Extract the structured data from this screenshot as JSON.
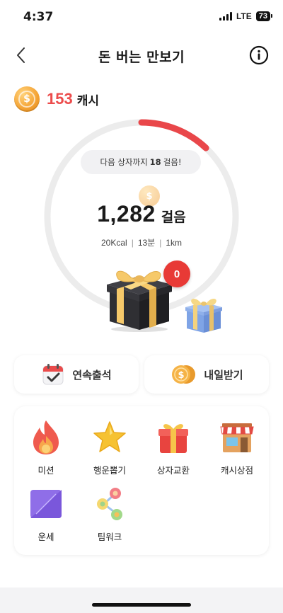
{
  "status_bar": {
    "time": "4:37",
    "network": "LTE",
    "battery": "73"
  },
  "header": {
    "title": "돈 버는 만보기"
  },
  "cash": {
    "amount": "153",
    "unit": "캐시"
  },
  "progress": {
    "next_box_prefix": "다음 상자까지",
    "next_box_steps": "18",
    "next_box_suffix": "걸음!",
    "ring_fill_fraction": 0.12
  },
  "steps": {
    "count": "1,282",
    "unit": "걸음"
  },
  "stats": {
    "kcal": "20Kcal",
    "minutes": "13분",
    "distance": "1km"
  },
  "gift": {
    "badge_count": "0"
  },
  "actions": {
    "attendance_label": "연속출석",
    "tomorrow_label": "내일받기"
  },
  "menu": {
    "items": [
      {
        "label": "미션",
        "icon": "flame-icon"
      },
      {
        "label": "행운뽑기",
        "icon": "star-icon"
      },
      {
        "label": "상자교환",
        "icon": "gift-box-icon"
      },
      {
        "label": "캐시상점",
        "icon": "store-icon"
      },
      {
        "label": "운세",
        "icon": "fortune-card-icon"
      },
      {
        "label": "팀워크",
        "icon": "team-network-icon"
      }
    ]
  },
  "colors": {
    "accent_red": "#ec4c4c",
    "ring_track": "#ececec",
    "badge_red": "#e83a36"
  }
}
